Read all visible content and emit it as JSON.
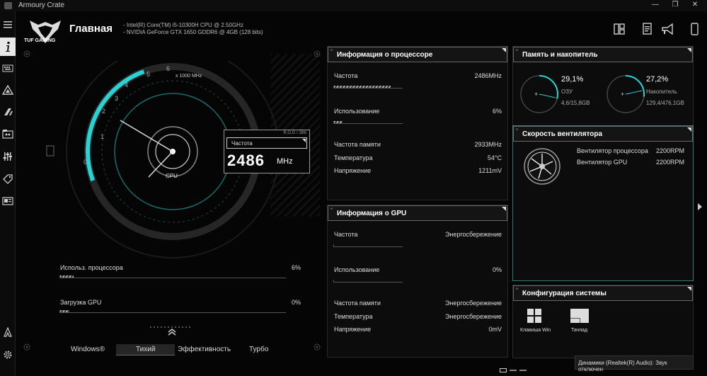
{
  "window": {
    "title": "Armoury Crate"
  },
  "header": {
    "logo_text": "TUF GAMING",
    "page_title": "Главная",
    "cpu_spec": "-  Intel(R) Core(TM) i5-10300H CPU @ 2.50GHz",
    "gpu_spec": "-  NVIDIA GeForce GTX 1650 GDDR6 @ 4GB (128 bits)"
  },
  "gauge": {
    "ticks": [
      "0",
      "1",
      "2",
      "3",
      "4",
      "5",
      "6"
    ],
    "unit": "x 1000 MHz",
    "center_label": "CPU",
    "freq_label": "Частота",
    "freq_value": "2486",
    "freq_unit": "MHz",
    "card_tag": "R.O.G / 2B6"
  },
  "usage": {
    "cpu_label": "Использ. процессора",
    "cpu_value": "6%",
    "gpu_label": "Загрузка GPU",
    "gpu_value": "0%"
  },
  "modes": [
    "Windows®",
    "Тихий",
    "Эффективность",
    "Турбо"
  ],
  "cpu_panel": {
    "title": "Информация о процессоре",
    "freq_label": "Частота",
    "freq_value": "2486MHz",
    "usage_label": "Использование",
    "usage_value": "6%",
    "mem_freq_label": "Частота памяти",
    "mem_freq_value": "2933MHz",
    "temp_label": "Температура",
    "temp_value": "54°C",
    "volt_label": "Напряжение",
    "volt_value": "1211mV"
  },
  "gpu_panel": {
    "title": "Информация о GPU",
    "freq_label": "Частота",
    "freq_value": "Энергосбережение",
    "usage_label": "Использование",
    "usage_value": "0%",
    "mem_freq_label": "Частота памяти",
    "mem_freq_value": "Энергосбережение",
    "temp_label": "Температура",
    "temp_value": "Энергосбережение",
    "volt_label": "Напряжение",
    "volt_value": "0mV"
  },
  "memory_panel": {
    "title": "Память и накопитель",
    "ram_pct": "29,1%",
    "ram_label": "ОЗУ",
    "ram_amount": "4,6/15,8GB",
    "disk_pct": "27,2%",
    "disk_label": "Накопитель",
    "disk_amount": "129,4/476,1GB"
  },
  "fan_panel": {
    "title": "Скорость вентилятора",
    "cpu_fan_label": "Вентилятор процессора",
    "cpu_fan_value": "2200RPM",
    "gpu_fan_label": "Вентилятор GPU",
    "gpu_fan_value": "2200RPM"
  },
  "config_panel": {
    "title": "Конфигурация системы",
    "win_key_label": "Клавиша Win",
    "touchpad_label": "Тачпад"
  },
  "toast": {
    "text": "Динамики (Realtek(R) Audio): Звук отключен"
  },
  "levels": {
    "cpu_freq_fraction": 0.41,
    "cpu_usage": 0.06,
    "gpu_usage": 0.0,
    "ram": 0.291,
    "disk": 0.272
  },
  "colors": {
    "accent": "#29d3d3",
    "background": "#050505",
    "panel_border": "#666666"
  }
}
